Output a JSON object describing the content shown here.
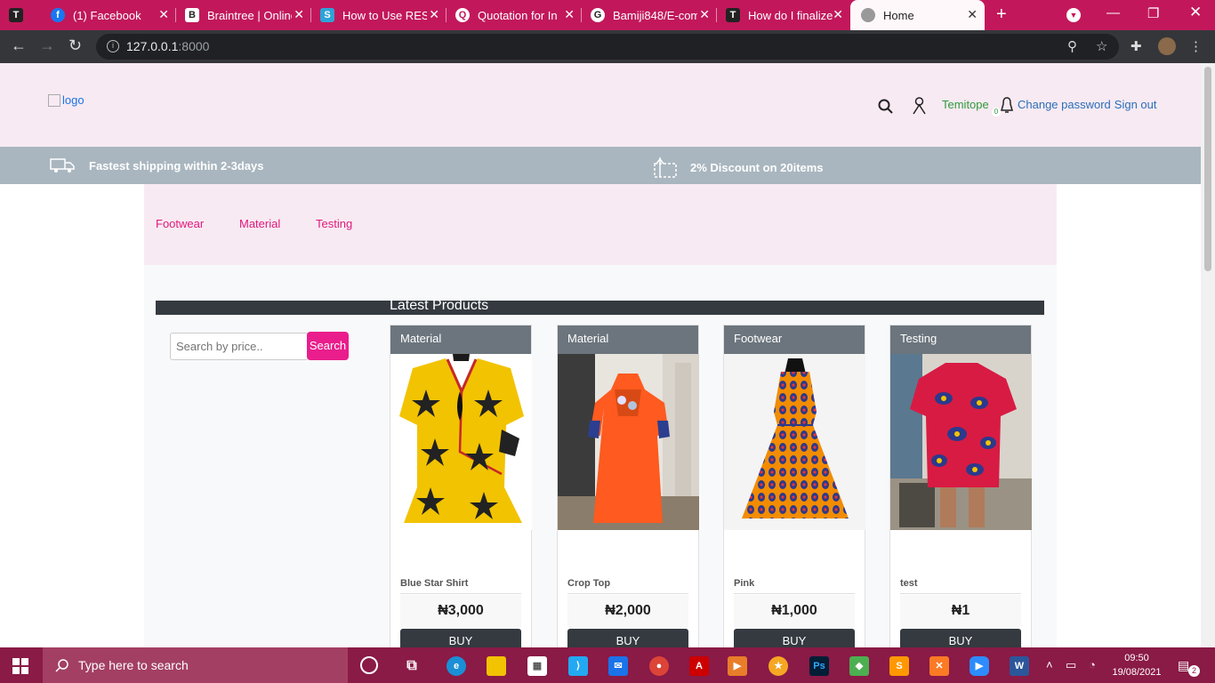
{
  "browser": {
    "tabs": [
      {
        "title": "",
        "favicon": "T",
        "favicon_color": "#222222"
      },
      {
        "title": "(1) Facebook",
        "favicon": "f",
        "favicon_color": "#1877f2"
      },
      {
        "title": "Braintree | Online",
        "favicon": "B",
        "favicon_color": "#222222"
      },
      {
        "title": "How to Use REST",
        "favicon": "S",
        "favicon_color": "#2ea3d7"
      },
      {
        "title": "Quotation for In",
        "favicon": "Q",
        "favicon_color": "#f0f0f0"
      },
      {
        "title": "Bamiji848/E-com",
        "favicon": "G",
        "favicon_color": "#222222"
      },
      {
        "title": "How do I finalize",
        "favicon": "T",
        "favicon_color": "#222222"
      },
      {
        "title": "Home",
        "favicon": "",
        "favicon_color": "#777777"
      }
    ],
    "address": {
      "host": "127.0.0.1",
      "port": ":8000"
    }
  },
  "header": {
    "logo_alt": "logo",
    "username": "Temitope",
    "notification_count": "0",
    "change_password": "Change password",
    "sign_out": "Sign out"
  },
  "promo": {
    "shipping": "Fastest shipping within 2-3days",
    "discount": "2% Discount on 20items"
  },
  "categories": [
    "Footwear",
    "Material",
    "Testing"
  ],
  "section_title": "Latest Products",
  "search": {
    "placeholder": "Search by price..",
    "button": "Search"
  },
  "products": [
    {
      "category": "Material",
      "name": "Blue Star Shirt",
      "price": "₦3,000",
      "buy": "BUY"
    },
    {
      "category": "Material",
      "name": "Crop Top",
      "price": "₦2,000",
      "buy": "BUY"
    },
    {
      "category": "Footwear",
      "name": "Pink",
      "price": "₦1,000",
      "buy": "BUY"
    },
    {
      "category": "Testing",
      "name": "test",
      "price": "₦1",
      "buy": "BUY"
    }
  ],
  "taskbar": {
    "search_placeholder": "Type here to search",
    "time": "09:50",
    "date": "19/08/2021",
    "notifications": "2"
  }
}
